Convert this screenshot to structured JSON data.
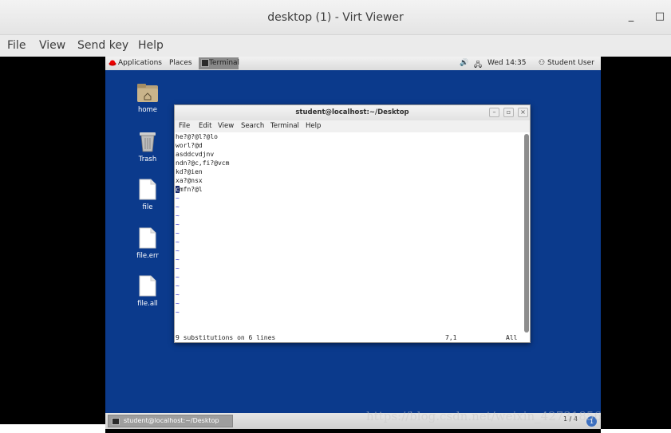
{
  "window": {
    "title": "desktop (1) - Virt Viewer",
    "minimize": "_",
    "maximize": "□"
  },
  "menubar": {
    "file": "File",
    "view": "View",
    "send_key": "Send key",
    "help": "Help"
  },
  "guest_topbar": {
    "applications": "Applications",
    "places": "Places",
    "terminal": "Terminal",
    "clock": "Wed 14:35",
    "user": "Student User"
  },
  "desktop_icons": [
    {
      "label": "home",
      "icon": "home-folder-icon"
    },
    {
      "label": "Trash",
      "icon": "trash-icon"
    },
    {
      "label": "file",
      "icon": "file-icon"
    },
    {
      "label": "file.err",
      "icon": "file-icon"
    },
    {
      "label": "file.all",
      "icon": "file-icon"
    }
  ],
  "terminal": {
    "title": "student@localhost:~/Desktop",
    "menu": {
      "file": "File",
      "edit": "Edit",
      "view": "View",
      "search": "Search",
      "terminal": "Terminal",
      "help": "Help"
    },
    "lines": [
      "he?@?@l?@lo",
      "worl?@d",
      "asddcvdjnv",
      "ndn?@c,fi?@vcm",
      "kd?@ien",
      "xa?@nsx"
    ],
    "cursor_line": {
      "cursor_char": "c",
      "rest": "mfn?@l"
    },
    "tilde": "~",
    "status_message": "9 substitutions on 6 lines",
    "status_position": "7,1",
    "status_scroll": "All"
  },
  "taskbar": {
    "task_label": "student@localhost:~/Desktop",
    "pager": "1 / 4",
    "notification": "1"
  },
  "watermark": "https://blog.csdn.net/weixin_42731856"
}
